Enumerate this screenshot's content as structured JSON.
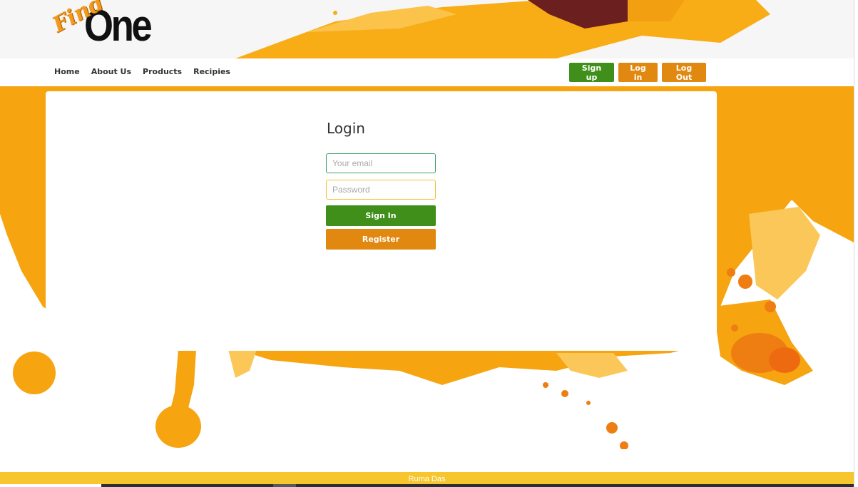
{
  "brand": {
    "logo_script": "Find",
    "logo_bold": "One"
  },
  "nav": {
    "links": [
      "Home",
      "About Us",
      "Products",
      "Recipies"
    ],
    "signup_label": "Sign up",
    "login_label": "Log in",
    "logout_label": "Log Out"
  },
  "login": {
    "title": "Login",
    "email_placeholder": "Your email",
    "password_placeholder": "Password",
    "signin_label": "Sign In",
    "register_label": "Register"
  },
  "footer": {
    "text": "Ruma Das"
  },
  "colors": {
    "green": "#3f8f1a",
    "orange": "#e0880f",
    "footer_yellow": "#f7c52c",
    "splash_orange": "#f6a410"
  },
  "icons": {
    "background": "orange-paint-splash"
  }
}
